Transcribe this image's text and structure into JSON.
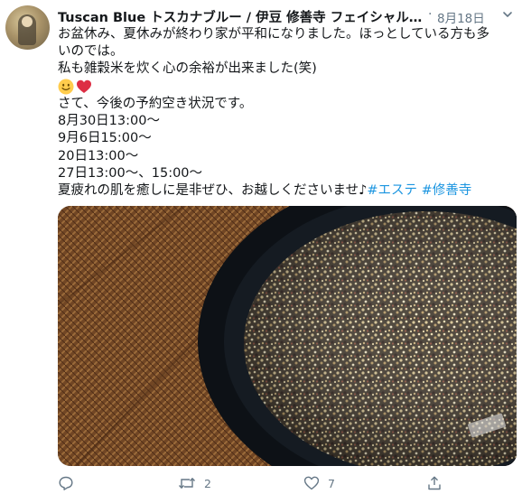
{
  "tweet": {
    "author_display": "Tuscan Blue トスカナブルー / 伊豆 修善寺 フェイシャル...",
    "separator": "·",
    "date": "8月18日",
    "body_lines": [
      "お盆休み、夏休みが終わり家が平和になりました。ほっとしている方も多",
      "いのでは。",
      "私も雑穀米を炊く心の余裕が出来ました(笑)"
    ],
    "emoji": [
      "slightly-smiling-face",
      "red-heart"
    ],
    "body_lines_2": [
      "さて、今後の予約空き状況です。",
      "8月30日13:00～",
      "9月6日15:00～",
      "20日13:00～",
      "27日13:00～、15:00～"
    ],
    "closing_text": "夏疲れの肌を癒しに是非ぜひ、お越しくださいませ♪",
    "hashtags": [
      "#エステ",
      "#修善寺"
    ],
    "media": {
      "icon": "photo-rice-cooker-with-multigrain-rice",
      "colors": {
        "rattan": "#8a5a32",
        "pot": "#0d1116",
        "grain": "#cdb98a"
      }
    },
    "actions": {
      "reply_count": "",
      "retweet_count": "2",
      "like_count": "7",
      "share_count": ""
    },
    "colors": {
      "text": "#14171a",
      "muted": "#657786",
      "link": "#1b95e0"
    }
  }
}
